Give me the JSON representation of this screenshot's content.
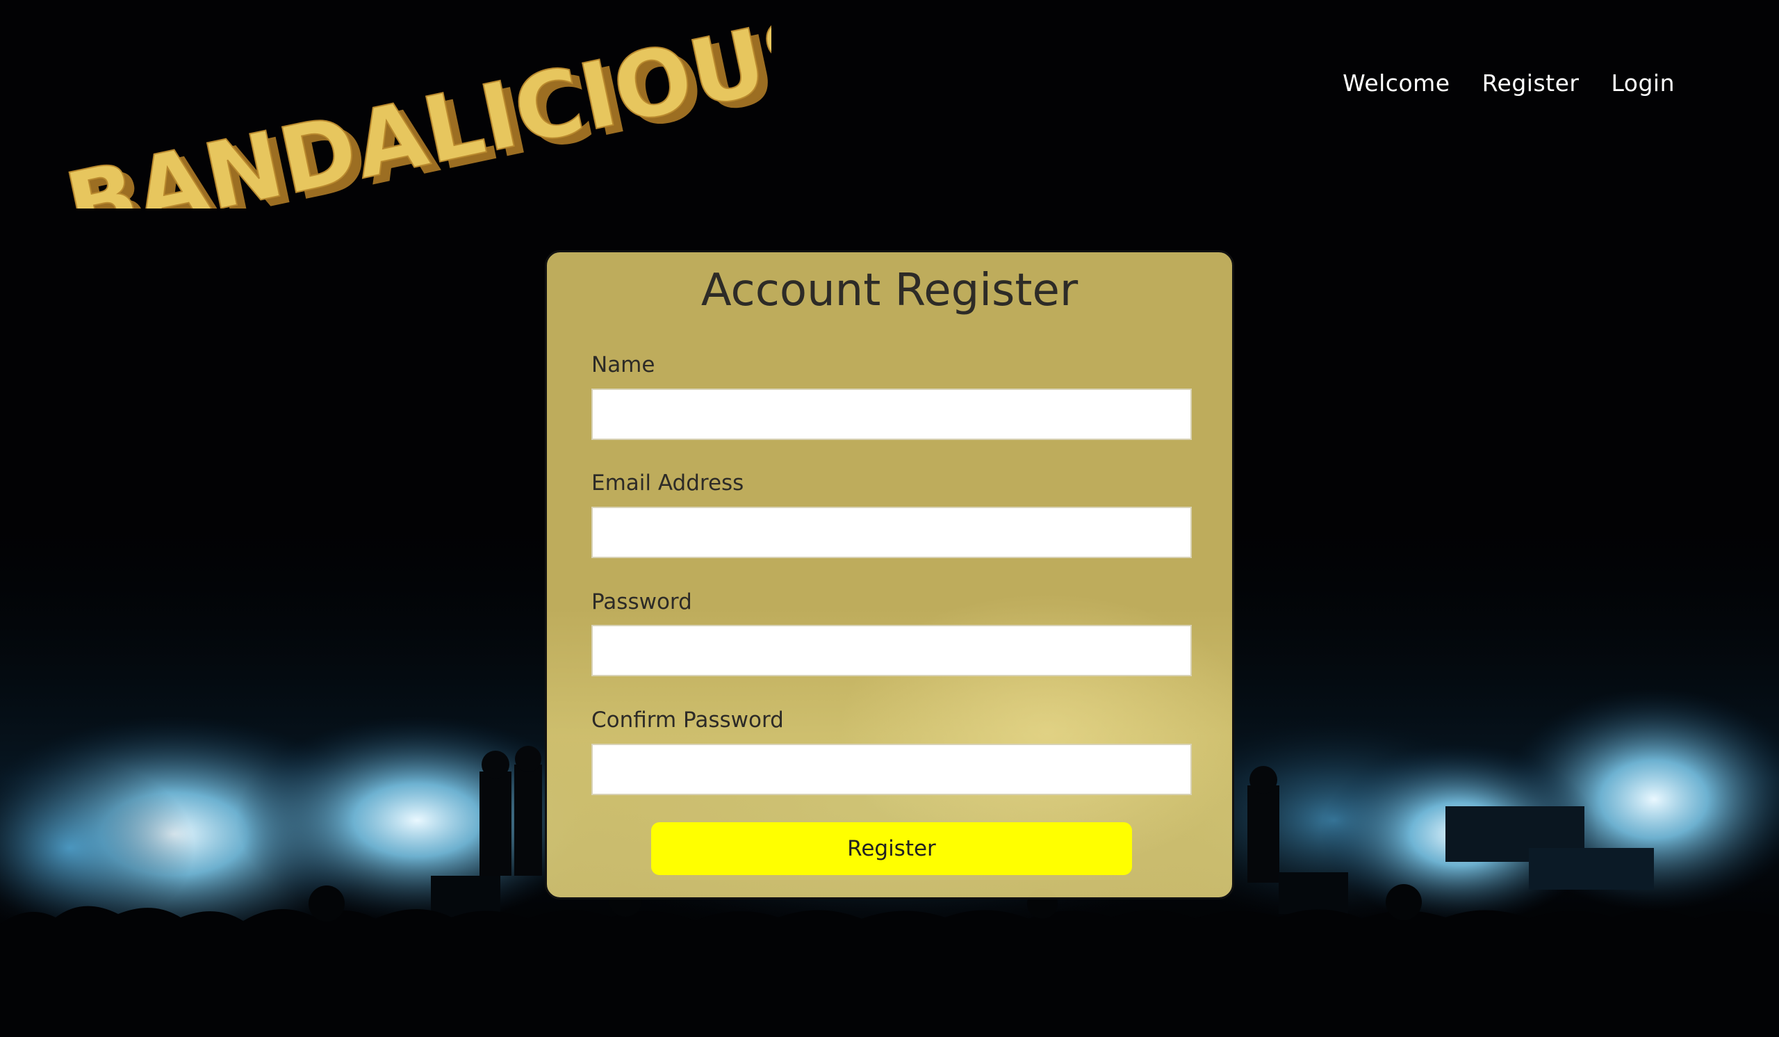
{
  "brand": {
    "logo_text": "BANDALICIOUS"
  },
  "nav": {
    "items": [
      {
        "label": "Welcome"
      },
      {
        "label": "Register"
      },
      {
        "label": "Login"
      }
    ]
  },
  "form": {
    "title": "Account Register",
    "fields": [
      {
        "label": "Name",
        "value": "",
        "placeholder": ""
      },
      {
        "label": "Email Address",
        "value": "",
        "placeholder": ""
      },
      {
        "label": "Password",
        "value": "",
        "placeholder": ""
      },
      {
        "label": "Confirm Password",
        "value": "",
        "placeholder": ""
      }
    ],
    "submit_label": "Register"
  },
  "colors": {
    "page_background": "#000000",
    "card_background": "#bdab5b",
    "button_background": "#ffff00",
    "logo_fill": "#e7c65e",
    "nav_text": "#ffffff",
    "stage_light": "#8fd6f5"
  }
}
